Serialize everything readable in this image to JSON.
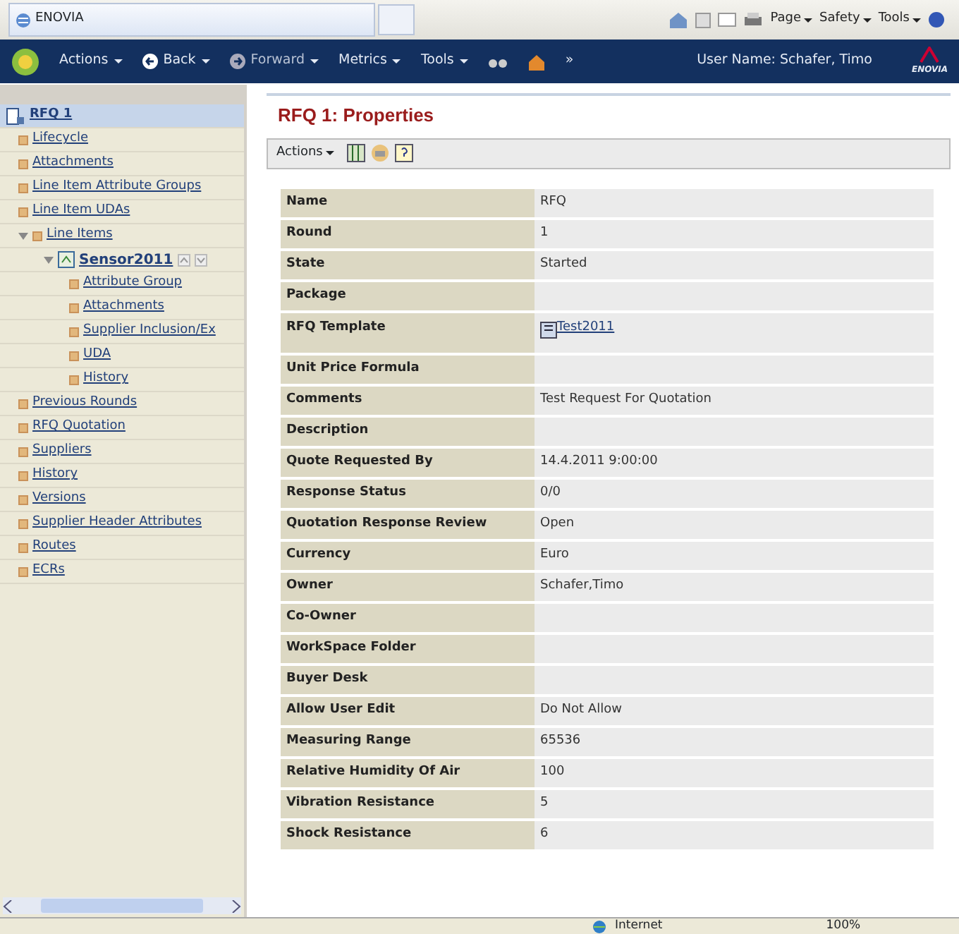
{
  "browser": {
    "tab_title": "ENOVIA",
    "commands": [
      {
        "label": "Page"
      },
      {
        "label": "Safety"
      },
      {
        "label": "Tools"
      }
    ]
  },
  "toolbar": {
    "items": [
      {
        "label": "Actions",
        "kind": "menu"
      },
      {
        "label": "Back",
        "kind": "back"
      },
      {
        "label": "Forward",
        "kind": "forward"
      },
      {
        "label": "Metrics",
        "kind": "menu"
      },
      {
        "label": "Tools",
        "kind": "menu"
      }
    ],
    "overflow": "»",
    "user": "User Name: Schafer, Timo",
    "logo_text": "ENOVIA"
  },
  "tree": {
    "items": [
      {
        "label": "RFQ 1",
        "kind": "root",
        "selected": true,
        "children": [
          {
            "label": "Lifecycle",
            "selected": false
          },
          {
            "label": "Attachments",
            "selected": false
          },
          {
            "label": "Line Item Attribute Groups",
            "selected": false
          },
          {
            "label": "Line Item UDAs",
            "selected": false
          },
          {
            "label": "Line Items",
            "selected": false,
            "expanded": true,
            "children": [
              {
                "label": "Sensor2011",
                "kind": "object",
                "selected": false,
                "expanded": true,
                "children": [
                  {
                    "label": "Attribute Group",
                    "selected": false
                  },
                  {
                    "label": "Attachments",
                    "selected": false
                  },
                  {
                    "label": "Supplier Inclusion/Ex",
                    "selected": false
                  },
                  {
                    "label": "UDA",
                    "selected": false
                  },
                  {
                    "label": "History",
                    "selected": false
                  }
                ]
              }
            ]
          },
          {
            "label": "Previous Rounds",
            "selected": false
          },
          {
            "label": "RFQ Quotation",
            "selected": false
          },
          {
            "label": "Suppliers",
            "selected": false
          },
          {
            "label": "History",
            "selected": false
          },
          {
            "label": "Versions",
            "selected": false
          },
          {
            "label": "Supplier Header Attributes",
            "selected": false
          },
          {
            "label": "Routes",
            "selected": false
          },
          {
            "label": "ECRs",
            "selected": false
          }
        ]
      }
    ]
  },
  "page": {
    "title": "RFQ 1: Properties",
    "actions_label": "Actions",
    "properties": [
      {
        "label": "Name",
        "value": "RFQ"
      },
      {
        "label": "Round",
        "value": "1"
      },
      {
        "label": "State",
        "value": "Started"
      },
      {
        "label": "Package"
      },
      {
        "label": "RFQ Template",
        "value": "Test2011",
        "kind": "link"
      },
      {
        "label": "Unit Price Formula"
      },
      {
        "label": "Comments",
        "value": "Test Request For Quotation"
      },
      {
        "label": "Description"
      },
      {
        "label": "Quote Requested By",
        "value": "14.4.2011 9:00:00"
      },
      {
        "label": "Response Status",
        "value": "0/0"
      },
      {
        "label": "Quotation Response Review",
        "value": "Open"
      },
      {
        "label": "Currency",
        "value": "Euro"
      },
      {
        "label": "Owner",
        "value": "Schafer,Timo"
      },
      {
        "label": "Co-Owner"
      },
      {
        "label": "WorkSpace Folder"
      },
      {
        "label": "Buyer Desk"
      },
      {
        "label": "Allow User Edit",
        "value": "Do Not Allow"
      },
      {
        "label": "Measuring Range",
        "value": "65536"
      },
      {
        "label": "Relative Humidity Of Air",
        "value": "100"
      },
      {
        "label": "Vibration Resistance",
        "value": "5"
      },
      {
        "label": "Shock Resistance",
        "value": "6"
      }
    ]
  },
  "status_bar": {
    "zone": "Internet",
    "zoom": "100%"
  }
}
